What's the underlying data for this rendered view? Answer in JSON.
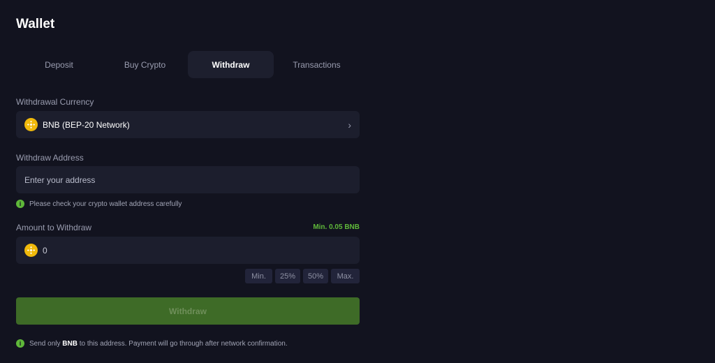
{
  "page": {
    "title": "Wallet"
  },
  "tabs": [
    {
      "label": "Deposit",
      "active": false
    },
    {
      "label": "Buy Crypto",
      "active": false
    },
    {
      "label": "Withdraw",
      "active": true
    },
    {
      "label": "Transactions",
      "active": false
    }
  ],
  "currency": {
    "label": "Withdrawal Currency",
    "value": "BNB (BEP-20 Network)",
    "icon": "bnb-coin-icon",
    "chevron": "›"
  },
  "address": {
    "label": "Withdraw Address",
    "placeholder": "Enter your address",
    "hint": "Please check your crypto wallet address carefully"
  },
  "amount": {
    "label": "Amount to Withdraw",
    "min_text": "Min. 0.05 BNB",
    "value": "0",
    "chips": [
      "Min.",
      "25%",
      "50%",
      "Max."
    ]
  },
  "submit": {
    "label": "Withdraw"
  },
  "note": {
    "prefix": "Send only ",
    "coin": "BNB",
    "suffix": " to this address. Payment will go through after network confirmation."
  },
  "colors": {
    "background": "#12131f",
    "field": "#1c1e2d",
    "accent_green": "#5fb83a",
    "button_green": "#3e6b27",
    "coin_gold": "#f0b90b"
  }
}
